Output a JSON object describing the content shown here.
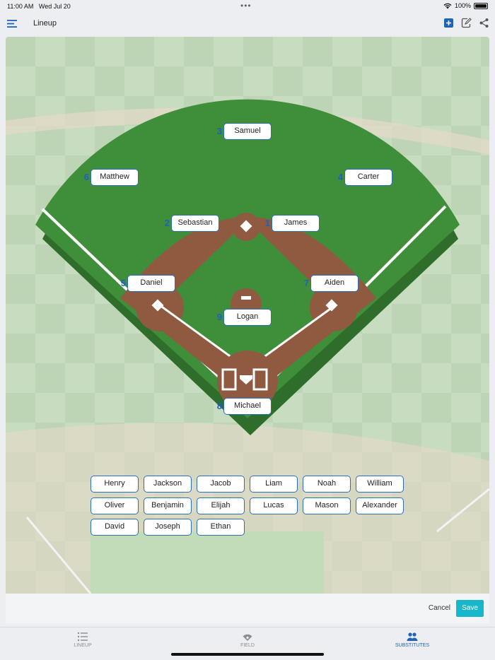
{
  "status_bar": {
    "time": "11:00 AM",
    "date": "Wed Jul 20",
    "battery": "100%",
    "dots": "•••"
  },
  "header": {
    "title": "Lineup",
    "icons": [
      "menu-icon",
      "add-icon",
      "edit-icon",
      "share-icon"
    ]
  },
  "field_positions": [
    {
      "num": "3",
      "name": "Samuel"
    },
    {
      "num": "6",
      "name": "Matthew"
    },
    {
      "num": "4",
      "name": "Carter"
    },
    {
      "num": "2",
      "name": "Sebastian"
    },
    {
      "num": "1",
      "name": "James"
    },
    {
      "num": "5",
      "name": "Daniel"
    },
    {
      "num": "7",
      "name": "Aiden"
    },
    {
      "num": "9",
      "name": "Logan"
    },
    {
      "num": "8",
      "name": "Michael"
    }
  ],
  "substitutes": [
    "Henry",
    "Jackson",
    "Jacob",
    "Liam",
    "Noah",
    "William",
    "Oliver",
    "Benjamin",
    "Elijah",
    "Lucas",
    "Mason",
    "Alexander",
    "David",
    "Joseph",
    "Ethan"
  ],
  "actions": {
    "cancel": "Cancel",
    "save": "Save"
  },
  "tabs": [
    {
      "label": "LINEUP",
      "active": false
    },
    {
      "label": "FIELD",
      "active": false
    },
    {
      "label": "SUBSTITUTES",
      "active": true
    }
  ],
  "colors": {
    "accent": "#1e63b8",
    "save": "#17b7cc",
    "grass": "#3f8f3a",
    "dirt": "#8f5a40"
  }
}
